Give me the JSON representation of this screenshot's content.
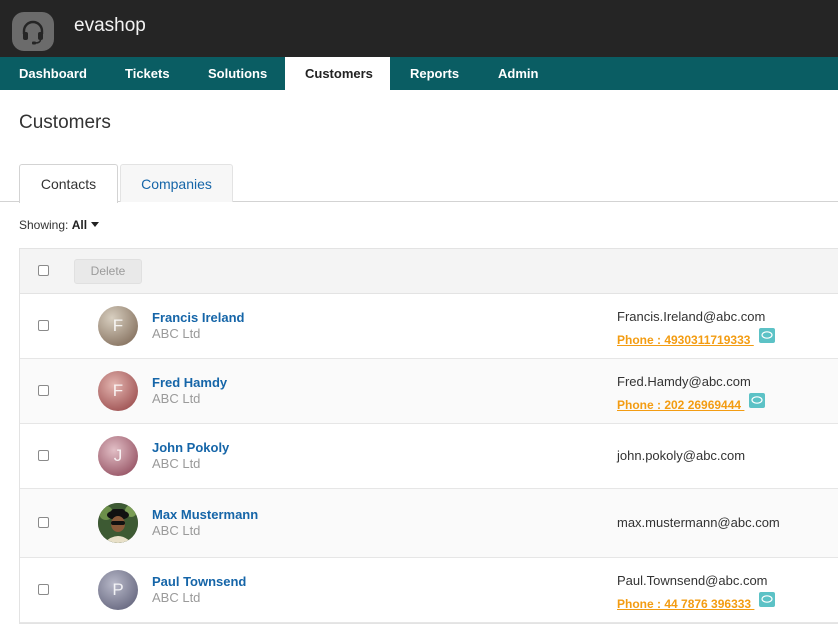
{
  "app": {
    "brand": "evashop"
  },
  "nav": [
    {
      "label": "Dashboard",
      "active": false
    },
    {
      "label": "Tickets",
      "active": false
    },
    {
      "label": "Solutions",
      "active": false
    },
    {
      "label": "Customers",
      "active": true
    },
    {
      "label": "Reports",
      "active": false
    },
    {
      "label": "Admin",
      "active": false
    }
  ],
  "page": {
    "title": "Customers"
  },
  "tabs": [
    {
      "label": "Contacts",
      "active": true
    },
    {
      "label": "Companies",
      "active": false
    }
  ],
  "filter": {
    "label": "Showing:",
    "value": "All"
  },
  "list": {
    "delete_label": "Delete",
    "rows": [
      {
        "name": "Francis Ireland",
        "company": "ABC Ltd",
        "initial": "F",
        "email": "Francis.Ireland@abc.com",
        "phone": "Phone : 4930311719333 ",
        "avatar_icon": "letter-avatar"
      },
      {
        "name": "Fred Hamdy",
        "company": "ABC Ltd",
        "initial": "F",
        "email": "Fred.Hamdy@abc.com",
        "phone": "Phone : 202 26969444 ",
        "avatar_icon": "letter-avatar"
      },
      {
        "name": "John Pokoly",
        "company": "ABC Ltd",
        "initial": "J",
        "email": "john.pokoly@abc.com",
        "phone": "",
        "avatar_icon": "letter-avatar"
      },
      {
        "name": "Max Mustermann",
        "company": "ABC Ltd",
        "initial": "",
        "email": "max.mustermann@abc.com",
        "phone": "",
        "avatar_icon": "photo-avatar"
      },
      {
        "name": "Paul Townsend",
        "company": "ABC Ltd",
        "initial": "P",
        "email": "Paul.Townsend@abc.com",
        "phone": "Phone : 44 7876 396333 ",
        "avatar_icon": "letter-avatar"
      }
    ]
  },
  "colors": {
    "topbar": "#252525",
    "nav": "#0a5d63",
    "link": "#1565a8",
    "phone": "#f39c12",
    "chat_icon": "#5cc2c6"
  }
}
